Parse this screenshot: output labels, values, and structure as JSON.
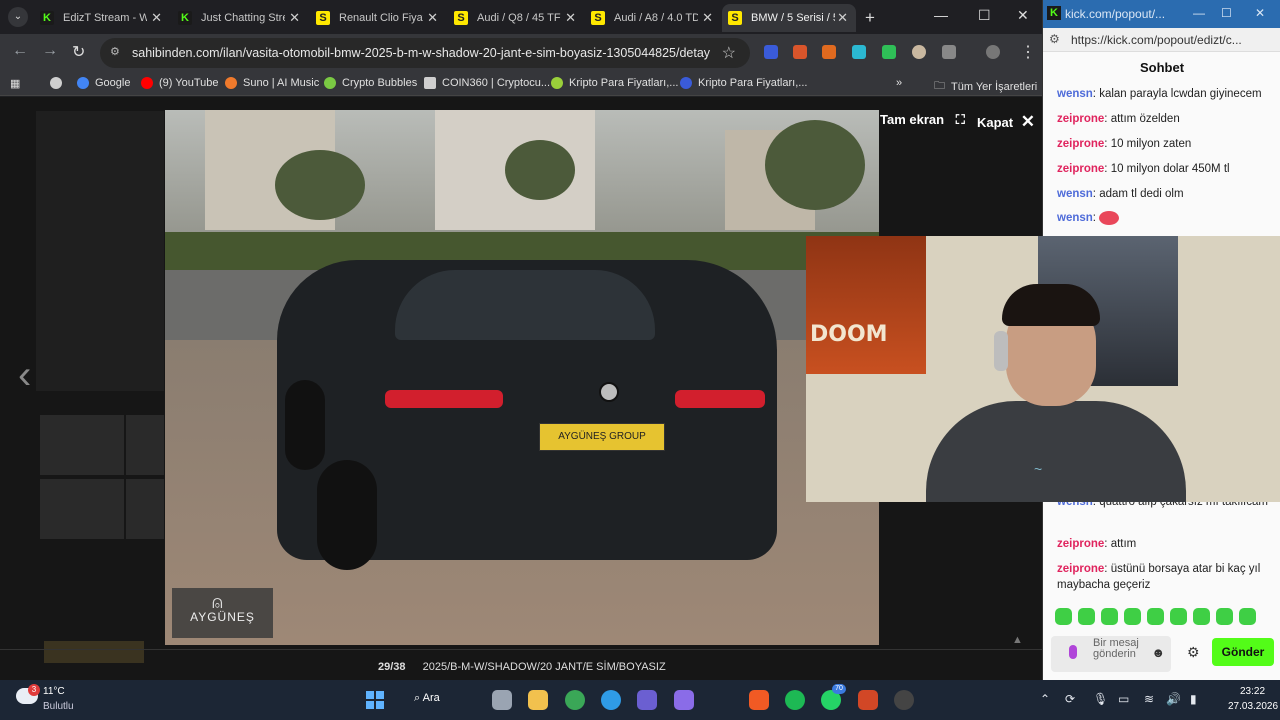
{
  "browser": {
    "tabs": [
      {
        "label": "EdizT Stream - W",
        "icon": "kick-icon",
        "active": false
      },
      {
        "label": "Just Chatting Stre",
        "icon": "kick-icon",
        "active": false
      },
      {
        "label": "Renault Clio Fiyat",
        "icon": "sahibinden-icon",
        "active": false
      },
      {
        "label": "Audi / Q8 / 45 TF",
        "icon": "sahibinden-icon",
        "active": false
      },
      {
        "label": "Audi / A8 / 4.0 TD",
        "icon": "sahibinden-icon",
        "active": false
      },
      {
        "label": "BMW / 5 Serisi / 5",
        "icon": "sahibinden-icon",
        "active": true
      }
    ],
    "url": "sahibinden.com/ilan/vasita-otomobil-bmw-2025-b-m-w-shadow-20-jant-e-sim-boyasiz-1305044825/detay",
    "bookmarks": [
      {
        "label": "Google",
        "color": "#4285f4"
      },
      {
        "label": "(9) YouTube",
        "color": "#ff0000"
      },
      {
        "label": "Suno | AI Music",
        "color": "#f07a2c"
      },
      {
        "label": "Crypto Bubbles",
        "color": "#7ac943"
      },
      {
        "label": "COIN360 | Cryptocu...",
        "color": "#cfcfcf"
      },
      {
        "label": "Kripto Para Fiyatları,...",
        "color": "#9ad03a"
      },
      {
        "label": "Kripto Para Fiyatları,...",
        "color": "#3a5bd9"
      }
    ],
    "bookmarks_all": "Tüm Yer İşaretleri"
  },
  "lightbox": {
    "fullscreen_label": "Tam ekran",
    "close_label": "Kapat",
    "counter": "29/38",
    "caption": "2025/B-M-W/SHADOW/20 JANT/E SİM/BOYASIZ",
    "plate_text": "AYGÜNEŞ GROUP",
    "dealer_logo": "AYGÜNEŞ"
  },
  "webcam": {
    "poster_text": "DOOM"
  },
  "kick": {
    "window_title": "kick.com/popout/...",
    "url": "https://kick.com/popout/edizt/c...",
    "chat_title": "Sohbet",
    "messages_top": [
      {
        "user": "wensn",
        "text": "kalan parayla lcwdan giyinecem",
        "type": "u1"
      },
      {
        "user": "zeiprone",
        "text": "attım özelden",
        "type": "u2"
      },
      {
        "user": "zeiprone",
        "text": "10 milyon zaten",
        "type": "u2"
      },
      {
        "user": "zeiprone",
        "text": "10 milyon dolar 450M tl",
        "type": "u2"
      },
      {
        "user": "wensn",
        "text": "adam tl dedi olm",
        "type": "u1"
      },
      {
        "user": "wensn",
        "text": "",
        "type": "u1"
      }
    ],
    "messages_bottom": [
      {
        "user": "wensn",
        "text": "quattro alıp çakarsız mı takılıcam",
        "type": "u1"
      },
      {
        "user": "zeiprone",
        "text": "attım",
        "type": "u2"
      },
      {
        "user": "zeiprone",
        "text": "üstünü borsaya atar bi kaç yıl maybacha geçeriz",
        "type": "u2"
      }
    ],
    "input_placeholder": "Bir mesaj gönderin",
    "send_label": "Gönder",
    "accent": "#53fc18"
  },
  "taskbar": {
    "weather_badge": "3",
    "temperature": "11°C",
    "condition": "Bulutlu",
    "search_label": "Ara",
    "whatsapp_badge": "70",
    "time": "23:22",
    "date": "27.03.2026"
  }
}
